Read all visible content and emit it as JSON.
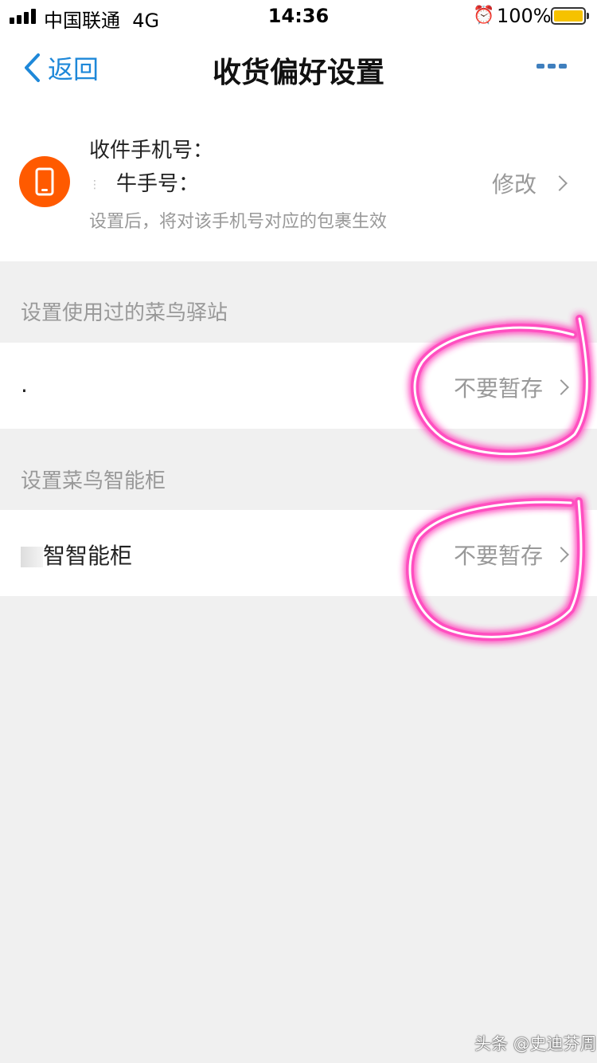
{
  "status_bar": {
    "carrier": "中国联通",
    "network": "4G",
    "time": "14:36",
    "battery": "100%"
  },
  "nav": {
    "back_label": "返回",
    "title": "收货偏好设置"
  },
  "phone_card": {
    "label": "收件手机号：",
    "value": "牛手号：",
    "hint": "设置后，将对该手机号对应的包裹生效",
    "action": "修改"
  },
  "stations": {
    "section_title": "设置使用过的菜鸟驿站",
    "items": [
      {
        "name": ".",
        "value": "不要暂存"
      }
    ]
  },
  "lockers": {
    "section_title": "设置菜鸟智能柜",
    "items": [
      {
        "name": "智智能柜",
        "value": "不要暂存"
      }
    ]
  },
  "colors": {
    "accent": "#1e88d9",
    "phone_icon_bg": "#ff5a00",
    "annotation": "#ff4fc0"
  },
  "watermark": "头条 @史迪芬周"
}
